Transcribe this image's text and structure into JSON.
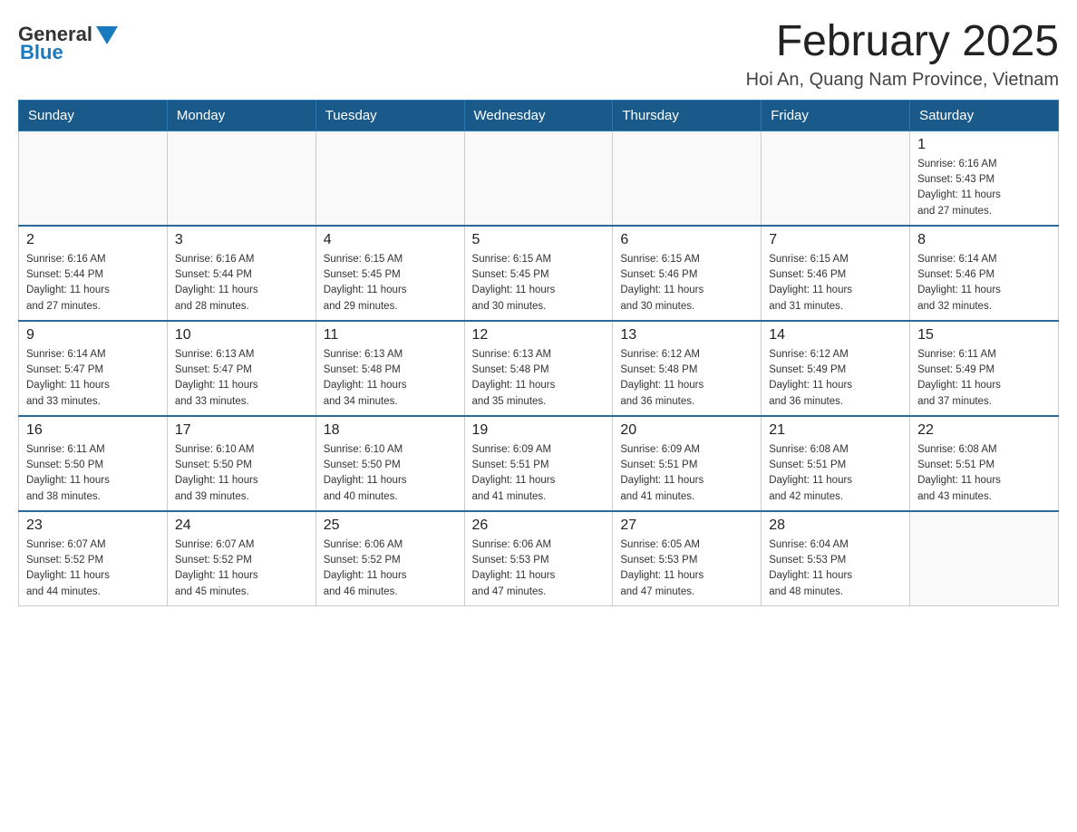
{
  "header": {
    "logo_general": "General",
    "logo_blue": "Blue",
    "main_title": "February 2025",
    "subtitle": "Hoi An, Quang Nam Province, Vietnam"
  },
  "days_of_week": [
    "Sunday",
    "Monday",
    "Tuesday",
    "Wednesday",
    "Thursday",
    "Friday",
    "Saturday"
  ],
  "weeks": [
    [
      {
        "day": "",
        "info": ""
      },
      {
        "day": "",
        "info": ""
      },
      {
        "day": "",
        "info": ""
      },
      {
        "day": "",
        "info": ""
      },
      {
        "day": "",
        "info": ""
      },
      {
        "day": "",
        "info": ""
      },
      {
        "day": "1",
        "info": "Sunrise: 6:16 AM\nSunset: 5:43 PM\nDaylight: 11 hours\nand 27 minutes."
      }
    ],
    [
      {
        "day": "2",
        "info": "Sunrise: 6:16 AM\nSunset: 5:44 PM\nDaylight: 11 hours\nand 27 minutes."
      },
      {
        "day": "3",
        "info": "Sunrise: 6:16 AM\nSunset: 5:44 PM\nDaylight: 11 hours\nand 28 minutes."
      },
      {
        "day": "4",
        "info": "Sunrise: 6:15 AM\nSunset: 5:45 PM\nDaylight: 11 hours\nand 29 minutes."
      },
      {
        "day": "5",
        "info": "Sunrise: 6:15 AM\nSunset: 5:45 PM\nDaylight: 11 hours\nand 30 minutes."
      },
      {
        "day": "6",
        "info": "Sunrise: 6:15 AM\nSunset: 5:46 PM\nDaylight: 11 hours\nand 30 minutes."
      },
      {
        "day": "7",
        "info": "Sunrise: 6:15 AM\nSunset: 5:46 PM\nDaylight: 11 hours\nand 31 minutes."
      },
      {
        "day": "8",
        "info": "Sunrise: 6:14 AM\nSunset: 5:46 PM\nDaylight: 11 hours\nand 32 minutes."
      }
    ],
    [
      {
        "day": "9",
        "info": "Sunrise: 6:14 AM\nSunset: 5:47 PM\nDaylight: 11 hours\nand 33 minutes."
      },
      {
        "day": "10",
        "info": "Sunrise: 6:13 AM\nSunset: 5:47 PM\nDaylight: 11 hours\nand 33 minutes."
      },
      {
        "day": "11",
        "info": "Sunrise: 6:13 AM\nSunset: 5:48 PM\nDaylight: 11 hours\nand 34 minutes."
      },
      {
        "day": "12",
        "info": "Sunrise: 6:13 AM\nSunset: 5:48 PM\nDaylight: 11 hours\nand 35 minutes."
      },
      {
        "day": "13",
        "info": "Sunrise: 6:12 AM\nSunset: 5:48 PM\nDaylight: 11 hours\nand 36 minutes."
      },
      {
        "day": "14",
        "info": "Sunrise: 6:12 AM\nSunset: 5:49 PM\nDaylight: 11 hours\nand 36 minutes."
      },
      {
        "day": "15",
        "info": "Sunrise: 6:11 AM\nSunset: 5:49 PM\nDaylight: 11 hours\nand 37 minutes."
      }
    ],
    [
      {
        "day": "16",
        "info": "Sunrise: 6:11 AM\nSunset: 5:50 PM\nDaylight: 11 hours\nand 38 minutes."
      },
      {
        "day": "17",
        "info": "Sunrise: 6:10 AM\nSunset: 5:50 PM\nDaylight: 11 hours\nand 39 minutes."
      },
      {
        "day": "18",
        "info": "Sunrise: 6:10 AM\nSunset: 5:50 PM\nDaylight: 11 hours\nand 40 minutes."
      },
      {
        "day": "19",
        "info": "Sunrise: 6:09 AM\nSunset: 5:51 PM\nDaylight: 11 hours\nand 41 minutes."
      },
      {
        "day": "20",
        "info": "Sunrise: 6:09 AM\nSunset: 5:51 PM\nDaylight: 11 hours\nand 41 minutes."
      },
      {
        "day": "21",
        "info": "Sunrise: 6:08 AM\nSunset: 5:51 PM\nDaylight: 11 hours\nand 42 minutes."
      },
      {
        "day": "22",
        "info": "Sunrise: 6:08 AM\nSunset: 5:51 PM\nDaylight: 11 hours\nand 43 minutes."
      }
    ],
    [
      {
        "day": "23",
        "info": "Sunrise: 6:07 AM\nSunset: 5:52 PM\nDaylight: 11 hours\nand 44 minutes."
      },
      {
        "day": "24",
        "info": "Sunrise: 6:07 AM\nSunset: 5:52 PM\nDaylight: 11 hours\nand 45 minutes."
      },
      {
        "day": "25",
        "info": "Sunrise: 6:06 AM\nSunset: 5:52 PM\nDaylight: 11 hours\nand 46 minutes."
      },
      {
        "day": "26",
        "info": "Sunrise: 6:06 AM\nSunset: 5:53 PM\nDaylight: 11 hours\nand 47 minutes."
      },
      {
        "day": "27",
        "info": "Sunrise: 6:05 AM\nSunset: 5:53 PM\nDaylight: 11 hours\nand 47 minutes."
      },
      {
        "day": "28",
        "info": "Sunrise: 6:04 AM\nSunset: 5:53 PM\nDaylight: 11 hours\nand 48 minutes."
      },
      {
        "day": "",
        "info": ""
      }
    ]
  ]
}
